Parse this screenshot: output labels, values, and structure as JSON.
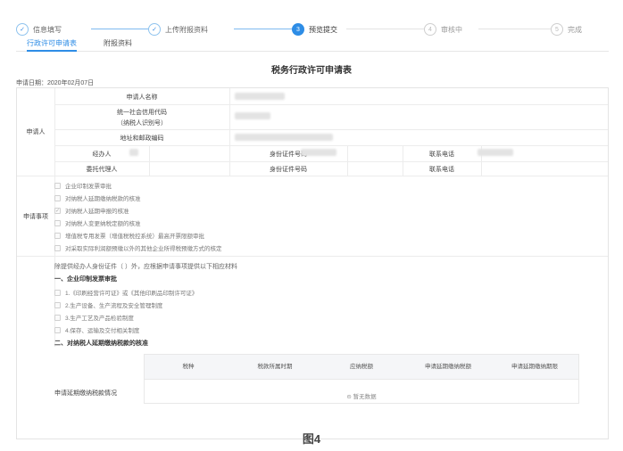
{
  "steps": [
    {
      "num": "✓",
      "label": "信息填写",
      "state": "done"
    },
    {
      "num": "✓",
      "label": "上传附报资料",
      "state": "done"
    },
    {
      "num": "3",
      "label": "预览提交",
      "state": "active"
    },
    {
      "num": "4",
      "label": "审核中",
      "state": "todo"
    },
    {
      "num": "5",
      "label": "完成",
      "state": "todo"
    }
  ],
  "tabs": [
    "行政许可申请表",
    "附报资料"
  ],
  "form": {
    "title": "税务行政许可申请表",
    "date": "申请日期：2020年02月07日",
    "applicant_section": "申请人",
    "name_label": "申请人名称",
    "credit_code_label_1": "统一社会信用代码",
    "credit_code_label_2": "（纳税人识别号）",
    "address_label": "地址和邮政编码",
    "handler_label": "经办人",
    "id_label": "身份证件号码",
    "phone_label": "联系电话",
    "agent_label": "委托代理人",
    "agent_id_label": "身份证件号码",
    "agent_phone_label": "联系电话"
  },
  "matters": {
    "label": "申请事项",
    "options": [
      {
        "text": "企业印制发票审批",
        "checked": false
      },
      {
        "text": "对纳税人延期缴纳税款的核准",
        "checked": false
      },
      {
        "text": "对纳税人延期申报的核准",
        "checked": true
      },
      {
        "text": "对纳税人变更纳税定额的核准",
        "checked": false
      },
      {
        "text": "增值税专用发票（增值税税控系统）最高开票限额审批",
        "checked": false
      },
      {
        "text": "对采取实际利润额预缴以外的其他企业所得税预缴方式的核定",
        "checked": false
      }
    ]
  },
  "details": {
    "note": "除提供经办人身份证件（ ）外，应根据申请事项提供以下相应材料",
    "section1": "一、企业印制发票审批",
    "section1_items": [
      "1.《印刷经营许可证》或《其他印刷品印制许可证》",
      "2.生产设备、生产流程及安全管理制度",
      "3.生产工艺及产品检验制度",
      "4.保存、运输及交付相关制度"
    ],
    "section2": "二、对纳税人延期缴纳税款的核准",
    "table_label": "申请延期缴纳税款情况",
    "columns": [
      "税种",
      "税款所属时期",
      "应纳税额",
      "申请延期缴纳税额",
      "申请延期缴纳期限"
    ],
    "empty_text": "暂无数据"
  },
  "figure_caption": "图4"
}
